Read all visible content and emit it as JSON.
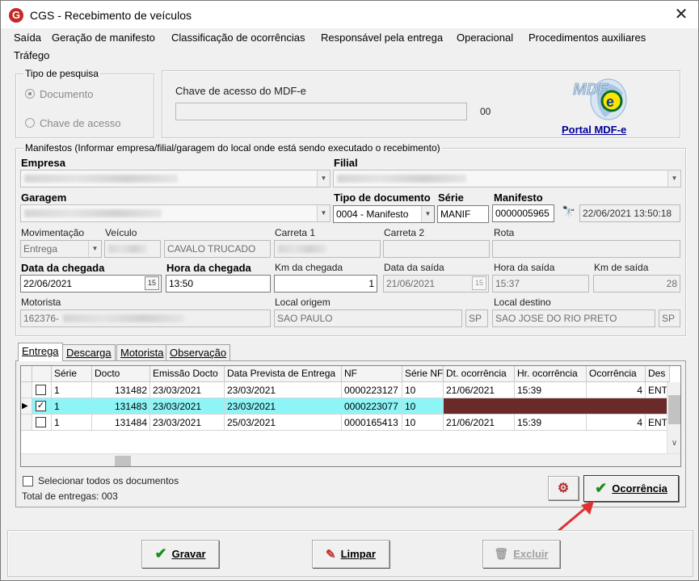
{
  "window": {
    "title": "CGS - Recebimento de veículos",
    "close": "✕"
  },
  "menu": [
    "Saída",
    "Geração de manifesto",
    "Classificação de ocorrências",
    "Responsável pela entrega",
    "Operacional",
    "Procedimentos auxiliares",
    "Tráfego"
  ],
  "tipo_pesquisa": {
    "legend": "Tipo de pesquisa",
    "options": [
      {
        "label": "Documento",
        "selected": true
      },
      {
        "label": "Chave de acesso",
        "selected": false
      }
    ]
  },
  "mdfe": {
    "label": "Chave de acesso do MDF-e",
    "value": "",
    "suffix": "00",
    "portal_link": "Portal MDF-e",
    "logo_text": "MDF e"
  },
  "manifestos": {
    "legend": "Manifestos (Informar empresa/filial/garagem do local onde está sendo executado o recebimento)",
    "empresa_label": "Empresa",
    "filial_label": "Filial",
    "garagem_label": "Garagem",
    "tipo_doc_label": "Tipo de documento",
    "tipo_doc_value": "0004 - Manifesto",
    "serie_label": "Série",
    "serie_value": "MANIF",
    "manifesto_label": "Manifesto",
    "manifesto_value": "0000005965",
    "manifesto_datetime": "22/06/2021 13:50:18",
    "movimentacao_label": "Movimentação",
    "movimentacao_value": "Entrega",
    "veiculo_label": "Veículo",
    "veiculo_desc": "CAVALO TRUCADO",
    "carreta1_label": "Carreta 1",
    "carreta2_label": "Carreta 2",
    "rota_label": "Rota",
    "data_chegada_label": "Data da chegada",
    "data_chegada_value": "22/06/2021",
    "hora_chegada_label": "Hora da chegada",
    "hora_chegada_value": "13:50",
    "km_chegada_label": "Km da chegada",
    "km_chegada_value": "1",
    "data_saida_label": "Data da saída",
    "data_saida_value": "21/06/2021",
    "hora_saida_label": "Hora da saída",
    "hora_saida_value": "15:37",
    "km_saida_label": "Km de saída",
    "km_saida_value": "28",
    "motorista_label": "Motorista",
    "motorista_value": "162376-",
    "local_origem_label": "Local origem",
    "local_origem_value": "SAO PAULO",
    "local_origem_uf": "SP",
    "local_destino_label": "Local destino",
    "local_destino_value": "SAO JOSE DO RIO PRETO",
    "local_destino_uf": "SP"
  },
  "tabs": [
    "Entrega",
    "Descarga",
    "Motorista",
    "Observação"
  ],
  "grid": {
    "columns": [
      "Série",
      "Docto",
      "Emissão Docto",
      "Data Prevista de Entrega",
      "NF",
      "Série NF",
      "Dt. ocorrência",
      "Hr. ocorrência",
      "Ocorrência",
      "Des"
    ],
    "rows": [
      {
        "checked": false,
        "serie": "1",
        "docto": "131482",
        "emissao": "23/03/2021",
        "prevista": "23/03/2021",
        "nf": "0000223127",
        "serie_nf": "10",
        "dt_oc": "21/06/2021",
        "hr_oc": "15:39",
        "ocorrencia": "4",
        "des": "ENT"
      },
      {
        "checked": true,
        "serie": "1",
        "docto": "131483",
        "emissao": "23/03/2021",
        "prevista": "23/03/2021",
        "nf": "0000223077",
        "serie_nf": "10",
        "dt_oc": "",
        "hr_oc": "",
        "ocorrencia": "",
        "des": ""
      },
      {
        "checked": false,
        "serie": "1",
        "docto": "131484",
        "emissao": "23/03/2021",
        "prevista": "25/03/2021",
        "nf": "0000165413",
        "serie_nf": "10",
        "dt_oc": "21/06/2021",
        "hr_oc": "15:39",
        "ocorrencia": "4",
        "des": "ENT"
      }
    ],
    "row_marker": "▶"
  },
  "footer": {
    "select_all_label": "Selecionar todos os documentos",
    "total_label": "Total de entregas: 003",
    "ocorrencia_button": "Ocorrência"
  },
  "buttons": {
    "gravar": "Gravar",
    "limpar": "Limpar",
    "excluir": "Excluir"
  },
  "colors": {
    "selected_row": "#8ef5f7",
    "dark_cell": "#6b2a2a",
    "link": "#00009c",
    "arrow": "#e03030"
  }
}
